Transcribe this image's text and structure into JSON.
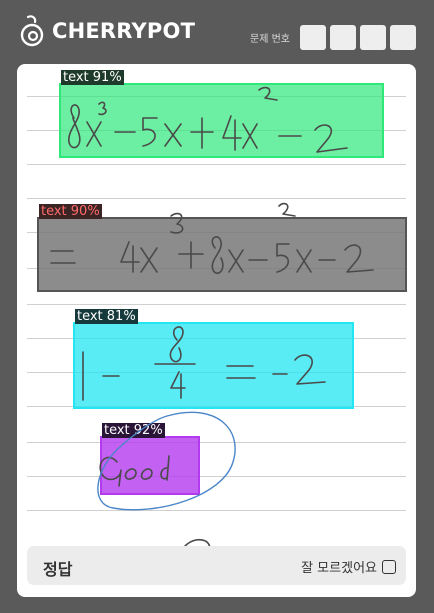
{
  "header": {
    "brand": "CHERRYPOT",
    "question_number_label": "문제 번호",
    "question_number_boxes": [
      "",
      "",
      "",
      ""
    ]
  },
  "detections": [
    {
      "label": "text 91%",
      "color": "#2ee87a"
    },
    {
      "label": "text 90%",
      "color": "#7a7a7a"
    },
    {
      "label": "text 81%",
      "color": "#22e6f2"
    },
    {
      "label": "text 92%",
      "color": "#b43af0"
    }
  ],
  "answer": {
    "label": "정답",
    "unsure_label": "잘 모르겠어요"
  },
  "colors": {
    "background": "#5a5a5a",
    "paper": "#ffffff",
    "ink": "#4a4a4a",
    "circle_ink": "#4a86c8"
  }
}
